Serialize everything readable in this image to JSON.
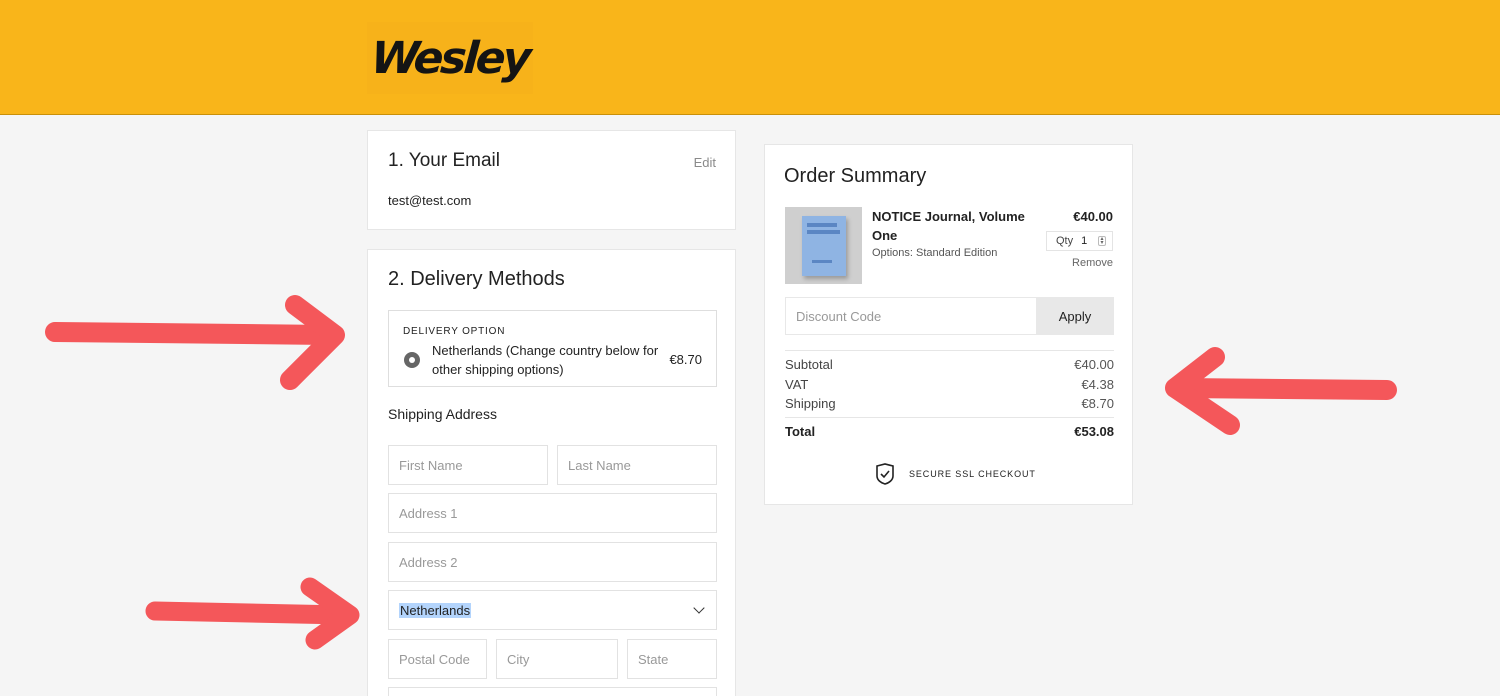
{
  "brand": {
    "logo": "Wesley",
    "header_color": "#f9b51a"
  },
  "email_section": {
    "title": "1.  Your Email",
    "edit_label": "Edit",
    "email": "test@test.com"
  },
  "delivery_section": {
    "title": "2.  Delivery Methods",
    "option_label": "DELIVERY OPTION",
    "option_text": "Netherlands (Change country below for other shipping options)",
    "option_price": "€8.70",
    "shipping_title": "Shipping Address",
    "fields": {
      "first_name": "First Name",
      "last_name": "Last Name",
      "address1": "Address 1",
      "address2": "Address 2",
      "country": "Netherlands",
      "postal_code": "Postal Code",
      "city": "City",
      "state": "State"
    }
  },
  "summary": {
    "title": "Order Summary",
    "product": {
      "name": "NOTICE Journal, Volume One",
      "options": "Options: Standard Edition",
      "price": "€40.00",
      "qty_label": "Qty",
      "qty_value": "1",
      "remove_label": "Remove"
    },
    "discount_placeholder": "Discount Code",
    "apply_label": "Apply",
    "subtotal_label": "Subtotal",
    "subtotal": "€40.00",
    "vat_label": "VAT",
    "vat": "€4.38",
    "shipping_label": "Shipping",
    "shipping": "€8.70",
    "total_label": "Total",
    "total": "€53.08",
    "secure_label": "SECURE SSL CHECKOUT"
  },
  "annotations": {
    "arrow_color": "#f4575a"
  }
}
